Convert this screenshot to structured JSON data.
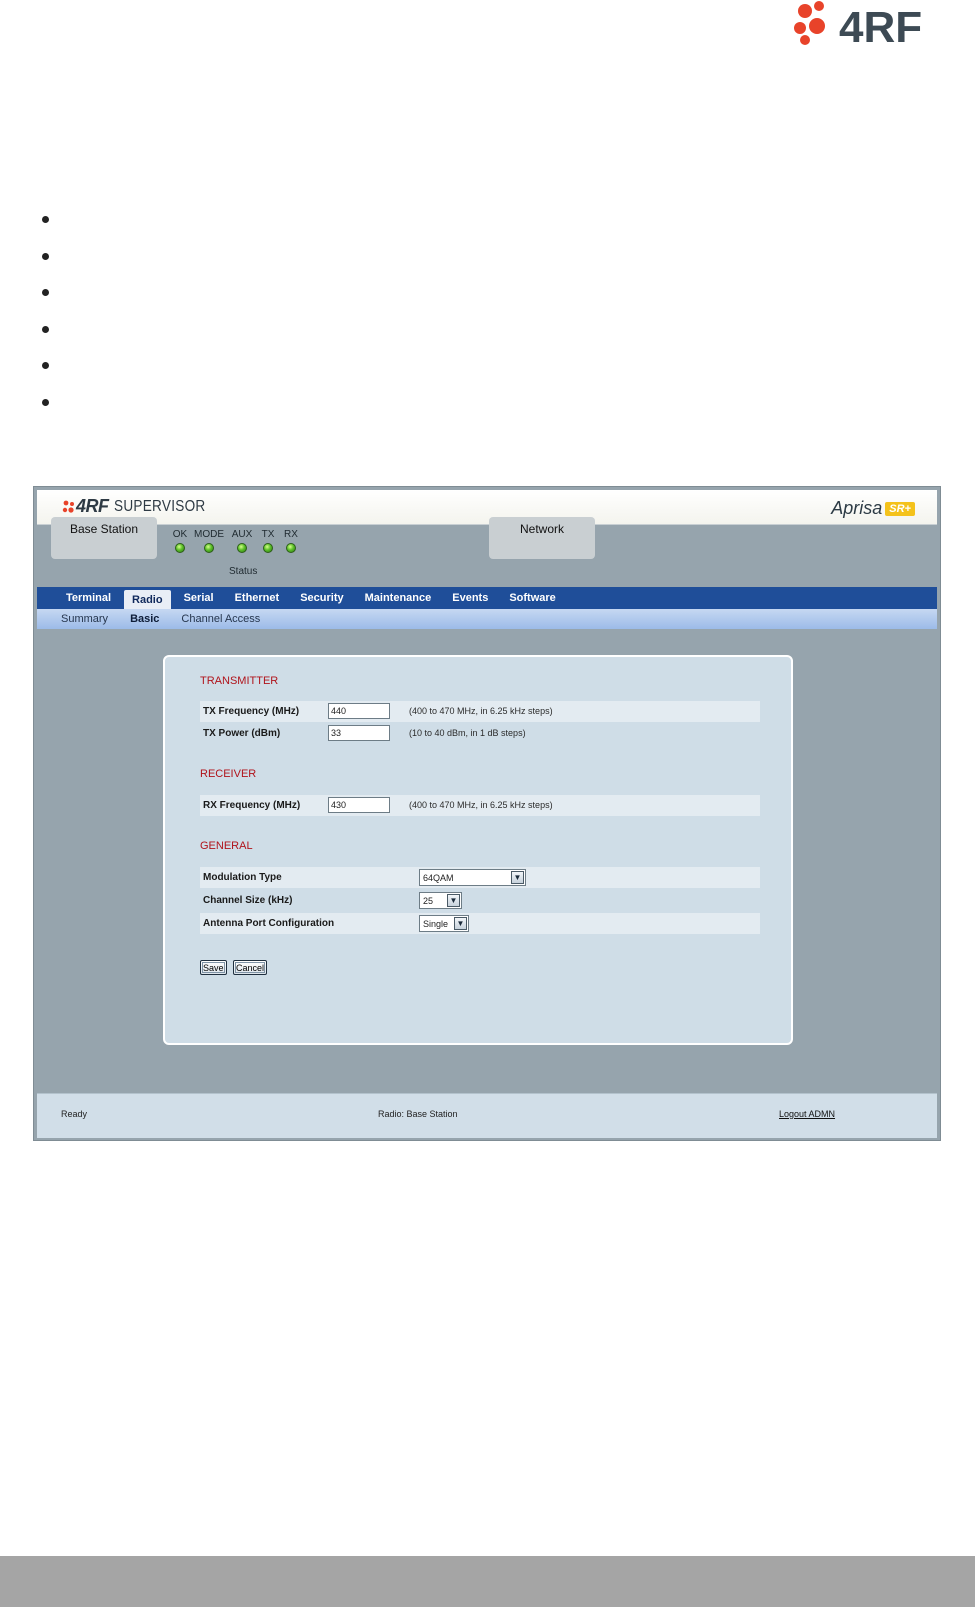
{
  "document": {
    "brand": "4RF",
    "bullet_count": 6
  },
  "app": {
    "header": {
      "logo_mark": "4RF",
      "logo_word": "SUPERVISOR",
      "product": "Aprisa",
      "product_badge": "SR+"
    },
    "status": {
      "terminal_box": "Base Station",
      "network_box": "Network",
      "leds": [
        {
          "label": "OK",
          "color": "#5dc12a"
        },
        {
          "label": "MODE",
          "color": "#5dc12a"
        },
        {
          "label": "AUX",
          "color": "#5dc12a"
        },
        {
          "label": "TX",
          "color": "#5dc12a"
        },
        {
          "label": "RX",
          "color": "#5dc12a"
        }
      ],
      "caption": "Status"
    },
    "nav": {
      "tabs": [
        "Terminal",
        "Radio",
        "Serial",
        "Ethernet",
        "Security",
        "Maintenance",
        "Events",
        "Software"
      ],
      "active": "Radio"
    },
    "subnav": {
      "items": [
        "Summary",
        "Basic",
        "Channel Access"
      ],
      "active": "Basic"
    },
    "form": {
      "transmitter": {
        "title": "TRANSMITTER",
        "tx_frequency": {
          "label": "TX Frequency (MHz)",
          "value": "440",
          "hint": "(400 to 470 MHz, in 6.25 kHz steps)"
        },
        "tx_power": {
          "label": "TX Power (dBm)",
          "value": "33",
          "hint": "(10 to 40 dBm, in 1 dB steps)"
        }
      },
      "receiver": {
        "title": "RECEIVER",
        "rx_frequency": {
          "label": "RX Frequency (MHz)",
          "value": "430",
          "hint": "(400 to 470 MHz, in 6.25 kHz steps)"
        }
      },
      "general": {
        "title": "GENERAL",
        "modulation": {
          "label": "Modulation Type",
          "value": "64QAM"
        },
        "channel_size": {
          "label": "Channel Size (kHz)",
          "value": "25"
        },
        "antenna": {
          "label": "Antenna Port Configuration",
          "value": "Single"
        }
      },
      "save_label": "Save",
      "cancel_label": "Cancel"
    },
    "statusbar": {
      "state": "Ready",
      "context": "Radio: Base Station",
      "logout": "Logout ADMN"
    }
  }
}
